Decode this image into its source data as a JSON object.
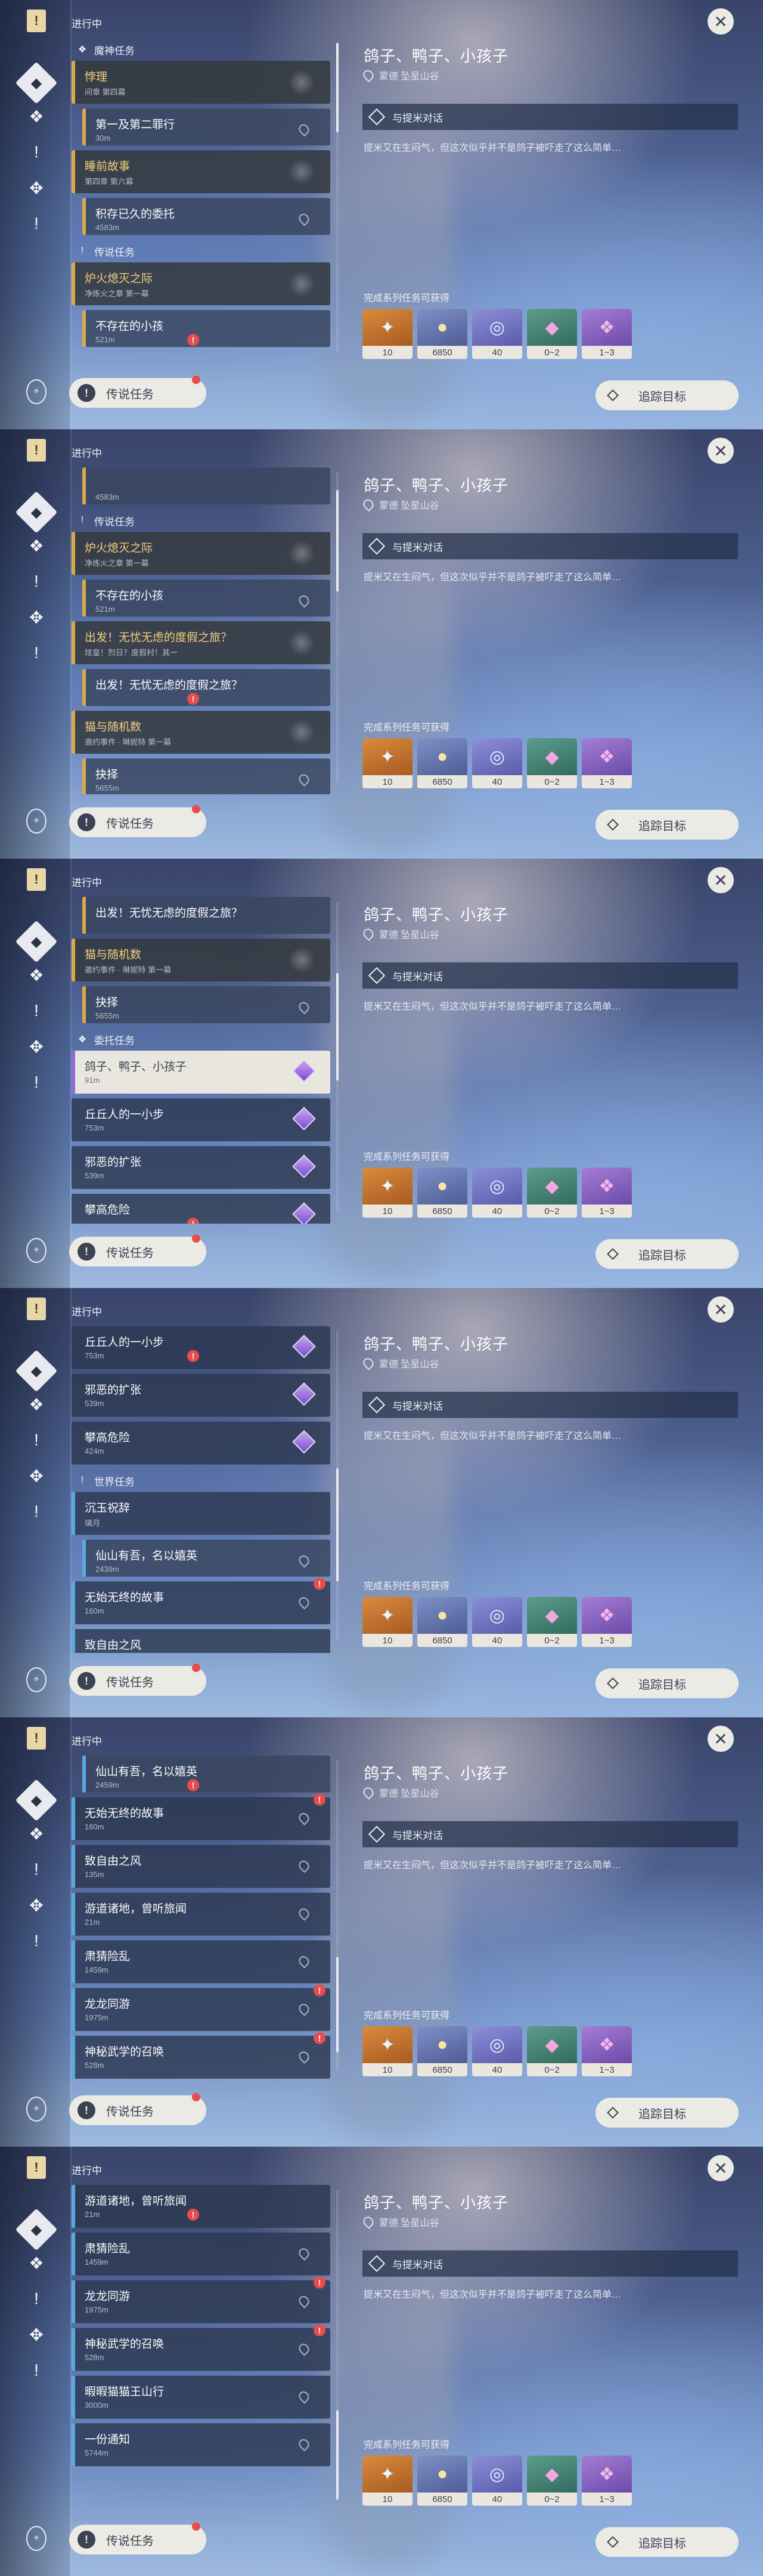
{
  "rail_icons": [
    "quest-book-icon",
    "quest-category-icon",
    "archon-quest-icon",
    "legend-quest-icon",
    "world-quest-icon",
    "commission-icon",
    "alert-icon"
  ],
  "list": {
    "title": "进行中",
    "legend_button": "传说任务"
  },
  "frames": [
    {
      "scroll_offset": 0,
      "thumb_top": 0,
      "thumb_h": 150,
      "items": [
        {
          "kind": "cat",
          "icon": "archon-quest-icon",
          "label": "魔神任务"
        },
        {
          "kind": "main",
          "name": "悖理",
          "meta": "间章 第四幕"
        },
        {
          "kind": "sub",
          "name": "第一及第二罪行",
          "meta": "30m",
          "pin": true
        },
        {
          "kind": "main",
          "name": "睡前故事",
          "meta": "第四章 第六幕"
        },
        {
          "kind": "sub",
          "name": "积存已久的委托",
          "meta": "4583m",
          "pin": true
        },
        {
          "kind": "cat",
          "icon": "legend-quest-icon",
          "label": "传说任务"
        },
        {
          "kind": "main",
          "name": "炉火熄灭之际",
          "meta": "净炼火之章 第一幕"
        },
        {
          "kind": "sub",
          "name": "不存在的小孩",
          "meta": "521m",
          "alert": true
        }
      ]
    },
    {
      "items": [
        {
          "kind": "sub",
          "name": "",
          "meta": "4583m"
        },
        {
          "kind": "cat",
          "icon": "legend-quest-icon",
          "label": "传说任务"
        },
        {
          "kind": "main",
          "name": "炉火熄灭之际",
          "meta": "净炼火之章 第一幕"
        },
        {
          "kind": "sub",
          "name": "不存在的小孩",
          "meta": "521m",
          "pin": true
        },
        {
          "kind": "main",
          "name": "出发！无忧无虑的度假之旅？",
          "meta": "炫皇！烈日？度假村！其一"
        },
        {
          "kind": "sub",
          "name": "出发！无忧无虑的度假之旅？",
          "meta": "",
          "alert": true
        },
        {
          "kind": "main",
          "name": "猫与随机数",
          "meta": "邀约事件 · 琳妮特 第一幕"
        },
        {
          "kind": "sub",
          "name": "抉择",
          "meta": "5655m",
          "pin": true
        }
      ]
    },
    {
      "items": [
        {
          "kind": "sub",
          "name": "出发！无忧无虑的度假之旅？",
          "meta": ""
        },
        {
          "kind": "main",
          "name": "猫与随机数",
          "meta": "邀约事件 · 琳妮特 第一幕"
        },
        {
          "kind": "sub",
          "name": "抉择",
          "meta": "5655m",
          "pin": true
        },
        {
          "kind": "cat",
          "icon": "commission-icon",
          "label": "委托任务"
        },
        {
          "kind": "comm",
          "name": "鸽子、鸭子、小孩子",
          "meta": "91m",
          "selected": true
        },
        {
          "kind": "comm",
          "name": "丘丘人的一小步",
          "meta": "753m"
        },
        {
          "kind": "comm",
          "name": "邪恶的扩张",
          "meta": "539m"
        },
        {
          "kind": "comm",
          "name": "攀高危险",
          "meta": "",
          "alert": true
        }
      ]
    },
    {
      "items": [
        {
          "kind": "comm",
          "name": "丘丘人的一小步",
          "meta": "753m",
          "alert": true
        },
        {
          "kind": "comm",
          "name": "邪恶的扩张",
          "meta": "539m"
        },
        {
          "kind": "comm",
          "name": "攀高危险",
          "meta": "424m"
        },
        {
          "kind": "cat",
          "icon": "world-quest-icon",
          "label": "世界任务"
        },
        {
          "kind": "world",
          "name": "沉玉祝辞",
          "meta": "璃月"
        },
        {
          "kind": "sub",
          "name": "仙山有吾，名以嬉英",
          "meta": "2439m",
          "pin": true
        },
        {
          "kind": "world",
          "name": "无始无终的故事",
          "meta": "160m",
          "pin": true,
          "alert": true
        },
        {
          "kind": "world",
          "name": "致自由之风",
          "meta": "",
          "alert": true
        }
      ]
    },
    {
      "items": [
        {
          "kind": "sub",
          "name": "仙山有吾，名以嬉英",
          "meta": "2459m",
          "alert": true
        },
        {
          "kind": "world",
          "name": "无始无终的故事",
          "meta": "160m",
          "pin": true,
          "alert": true
        },
        {
          "kind": "world",
          "name": "致自由之风",
          "meta": "135m",
          "pin": true
        },
        {
          "kind": "world",
          "name": "游道诸地，曾听旅闻",
          "meta": "21m",
          "pin": true
        },
        {
          "kind": "world",
          "name": "肃猜险乱",
          "meta": "1459m",
          "pin": true
        },
        {
          "kind": "world",
          "name": "龙龙同游",
          "meta": "1975m",
          "pin": true,
          "alert": true
        },
        {
          "kind": "world",
          "name": "神秘武学的召唤",
          "meta": "528m",
          "pin": true,
          "alert": true
        },
        {
          "kind": "world",
          "name": "暇暇猫猫王山行",
          "meta": "",
          "pin": true
        }
      ]
    },
    {
      "items": [
        {
          "kind": "world",
          "name": "游道诸地，曾听旅闻",
          "meta": "21m",
          "alert": true
        },
        {
          "kind": "world",
          "name": "肃猜险乱",
          "meta": "1459m",
          "pin": true
        },
        {
          "kind": "world",
          "name": "龙龙同游",
          "meta": "1975m",
          "pin": true,
          "alert": true
        },
        {
          "kind": "world",
          "name": "神秘武学的召唤",
          "meta": "528m",
          "pin": true,
          "alert": true
        },
        {
          "kind": "world",
          "name": "暇暇猫猫王山行",
          "meta": "3000m",
          "pin": true
        },
        {
          "kind": "world",
          "name": "一份通知",
          "meta": "5744m",
          "pin": true
        }
      ]
    }
  ],
  "detail": {
    "title": "鸽子、鸭子、小孩子",
    "location": "蒙德 坠星山谷",
    "step": "与提米对话",
    "description": "提米又在生闷气，但这次似乎并不是鸽子被吓走了这么简单…",
    "rewards_label": "完成系列任务可获得",
    "rewards": [
      {
        "icon": "primogem-icon",
        "qty": "10",
        "style": "r-orange",
        "glyph": "✦"
      },
      {
        "icon": "mora-icon",
        "qty": "6850",
        "style": "r-blue",
        "glyph": "●"
      },
      {
        "icon": "adventure-exp-icon",
        "qty": "40",
        "style": "r-purple",
        "glyph": "◎"
      },
      {
        "icon": "crystal-chunk-icon",
        "qty": "0~2",
        "style": "r-green",
        "glyph": "◆"
      },
      {
        "icon": "ore-icon",
        "qty": "1~3",
        "style": "r-violet",
        "glyph": "❖"
      }
    ],
    "track_button": "追踪目标"
  }
}
